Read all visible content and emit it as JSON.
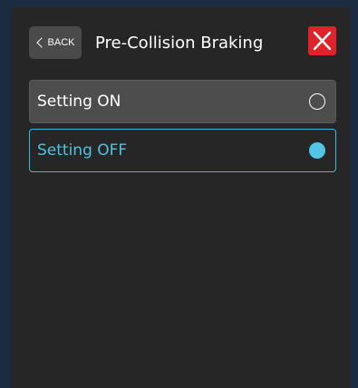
{
  "header": {
    "back_label": "BACK",
    "title": "Pre-Collision Braking",
    "close_icon": "close-icon"
  },
  "options": [
    {
      "label": "Setting ON",
      "selected": false
    },
    {
      "label": "Setting OFF",
      "selected": true
    }
  ],
  "colors": {
    "background": "#262626",
    "accent": "#3fb8d9",
    "close": "#e0232a",
    "option_unselected": "#4d4d4d"
  }
}
